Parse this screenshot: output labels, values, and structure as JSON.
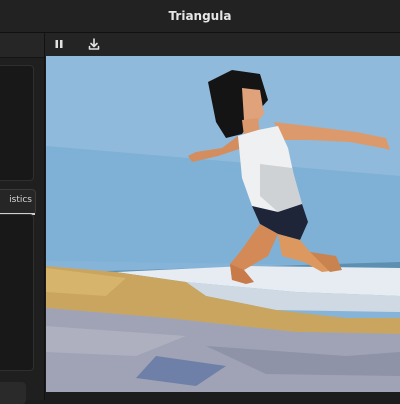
{
  "window": {
    "title": "Triangula"
  },
  "sidebar": {
    "tab_label": "istics"
  },
  "toolbar": {
    "pause_icon": "pause-icon",
    "download_icon": "download-icon"
  },
  "canvas": {
    "description_colors": {
      "sky": "#86b4d8",
      "sea": "#5d8fb0",
      "sand": "#c9a560",
      "wet_sand": "#9fa3b5"
    }
  }
}
